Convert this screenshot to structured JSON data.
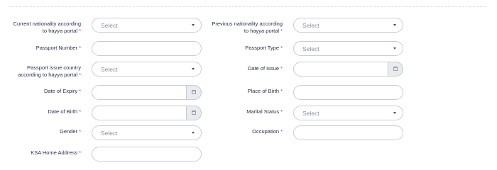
{
  "form": {
    "left": [
      {
        "key": "current_nationality",
        "label_line1": "Current nationality according",
        "label_line2": "to hayya portal",
        "required": "*",
        "type": "select",
        "value": "Select"
      },
      {
        "key": "passport_number",
        "label_line1": "Passport Number",
        "label_line2": "",
        "required": "*",
        "type": "text",
        "value": ""
      },
      {
        "key": "passport_issue_country",
        "label_line1": "Passport issue country",
        "label_line2": "according to hayya portal",
        "required": "*",
        "type": "select",
        "value": "Select"
      },
      {
        "key": "date_of_expiry",
        "label_line1": "Date of Expiry",
        "label_line2": "",
        "required": "*",
        "type": "date",
        "value": ""
      },
      {
        "key": "date_of_birth",
        "label_line1": "Date of Birth",
        "label_line2": "",
        "required": "*",
        "type": "date",
        "value": ""
      },
      {
        "key": "gender",
        "label_line1": "Gender",
        "label_line2": "",
        "required": "*",
        "type": "select",
        "value": "Select"
      },
      {
        "key": "ksa_home_address",
        "label_line1": "KSA Home Address",
        "label_line2": "",
        "required": "*",
        "type": "text",
        "value": ""
      }
    ],
    "right": [
      {
        "key": "previous_nationality",
        "label_line1": "Previous nationality according",
        "label_line2": "to hayya portal",
        "required": "*",
        "type": "select",
        "value": "Select"
      },
      {
        "key": "passport_type",
        "label_line1": "Passport Type",
        "label_line2": "",
        "required": "*",
        "type": "select",
        "value": "Select"
      },
      {
        "key": "date_of_issue",
        "label_line1": "Date of Issue",
        "label_line2": "",
        "required": "*",
        "type": "date",
        "value": ""
      },
      {
        "key": "place_of_birth",
        "label_line1": "Place of Birth",
        "label_line2": "",
        "required": "*",
        "type": "text",
        "value": ""
      },
      {
        "key": "marital_status",
        "label_line1": "Marital Status",
        "label_line2": "",
        "required": "*",
        "type": "select",
        "value": "Select"
      },
      {
        "key": "occupation",
        "label_line1": "Occupation",
        "label_line2": "",
        "required": "*",
        "type": "text",
        "value": ""
      }
    ]
  },
  "icons": {
    "select_caret": "chevron-down-icon",
    "date_picker": "calendar-icon"
  },
  "colors": {
    "required": "#e0282e",
    "label": "#2a2f4d",
    "border": "#c8ccd4",
    "placeholder": "#8a8f9c"
  }
}
